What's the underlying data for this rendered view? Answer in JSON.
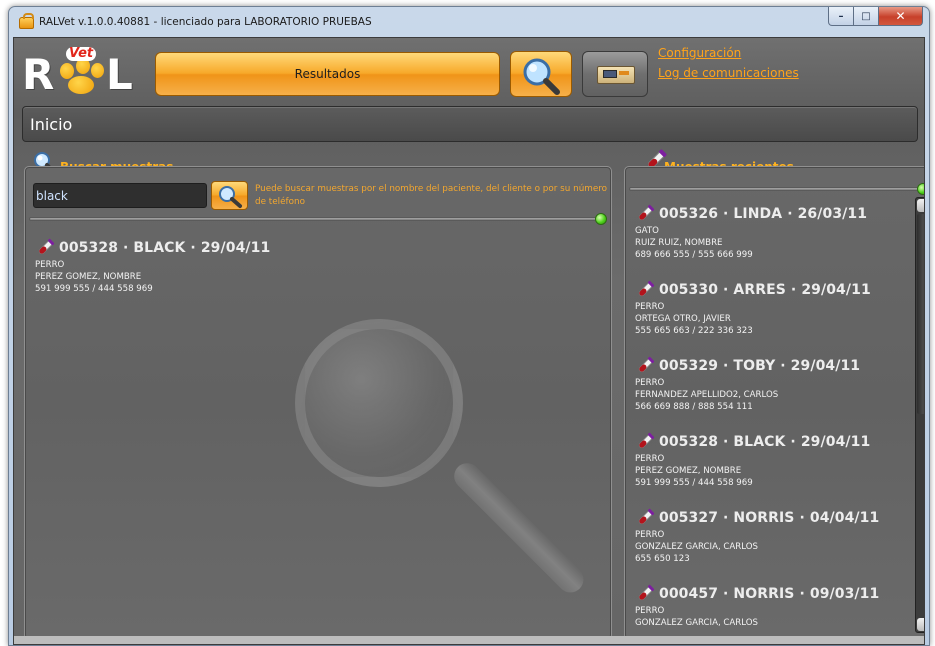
{
  "window": {
    "title": "RALVet v.1.0.0.40881 - licenciado para LABORATORIO PRUEBAS",
    "controls": {
      "minimize": "–",
      "maximize": "□",
      "close": "✕"
    }
  },
  "header": {
    "logo_badge": "Vet",
    "logo_left": "R",
    "logo_right": "L",
    "results_button": "Resultados",
    "links": [
      "Configuración",
      "Log de comunicaciones"
    ]
  },
  "breadcrumb": "Inicio",
  "search_panel": {
    "title": "Buscar muestras",
    "query": "black",
    "hint": "Puede buscar muestras por el nombre del paciente, del cliente o por su número de teléfono",
    "results": [
      {
        "heading": "005328 · BLACK · 29/04/11",
        "species": "PERRO",
        "owner": "PEREZ GOMEZ, NOMBRE",
        "phones": "591 999 555 / 444 558 969"
      }
    ]
  },
  "recent_panel": {
    "title": "Muestras recientes",
    "items": [
      {
        "heading": "005326 · LINDA · 26/03/11",
        "species": "GATO",
        "owner": "RUIZ RUIZ, NOMBRE",
        "phones": "689 666 555 / 555 666 999"
      },
      {
        "heading": "005330 · ARRES · 29/04/11",
        "species": "PERRO",
        "owner": "ORTEGA OTRO, JAVIER",
        "phones": "555 665 663 / 222 336 323"
      },
      {
        "heading": "005329 · TOBY · 29/04/11",
        "species": "PERRO",
        "owner": "FERNANDEZ APELLIDO2, CARLOS",
        "phones": "566 669 888 / 888 554 111"
      },
      {
        "heading": "005328 · BLACK · 29/04/11",
        "species": "PERRO",
        "owner": "PEREZ GOMEZ, NOMBRE",
        "phones": "591 999 555 / 444 558 969"
      },
      {
        "heading": "005327 · NORRIS · 04/04/11",
        "species": "PERRO",
        "owner": "GONZALEZ GARCIA, CARLOS",
        "phones": "655 650 123"
      },
      {
        "heading": "000457 · NORRIS · 09/03/11",
        "species": "PERRO",
        "owner": "GONZALEZ GARCIA, CARLOS",
        "phones": ""
      }
    ]
  },
  "colors": {
    "accent_orange": "#ffa31a",
    "panel_title": "#ffb21e",
    "status_green": "#4fd11c"
  },
  "icons": {
    "search": "magnifier-icon",
    "sample": "test-tube-icon",
    "device": "analyzer-device-icon"
  }
}
